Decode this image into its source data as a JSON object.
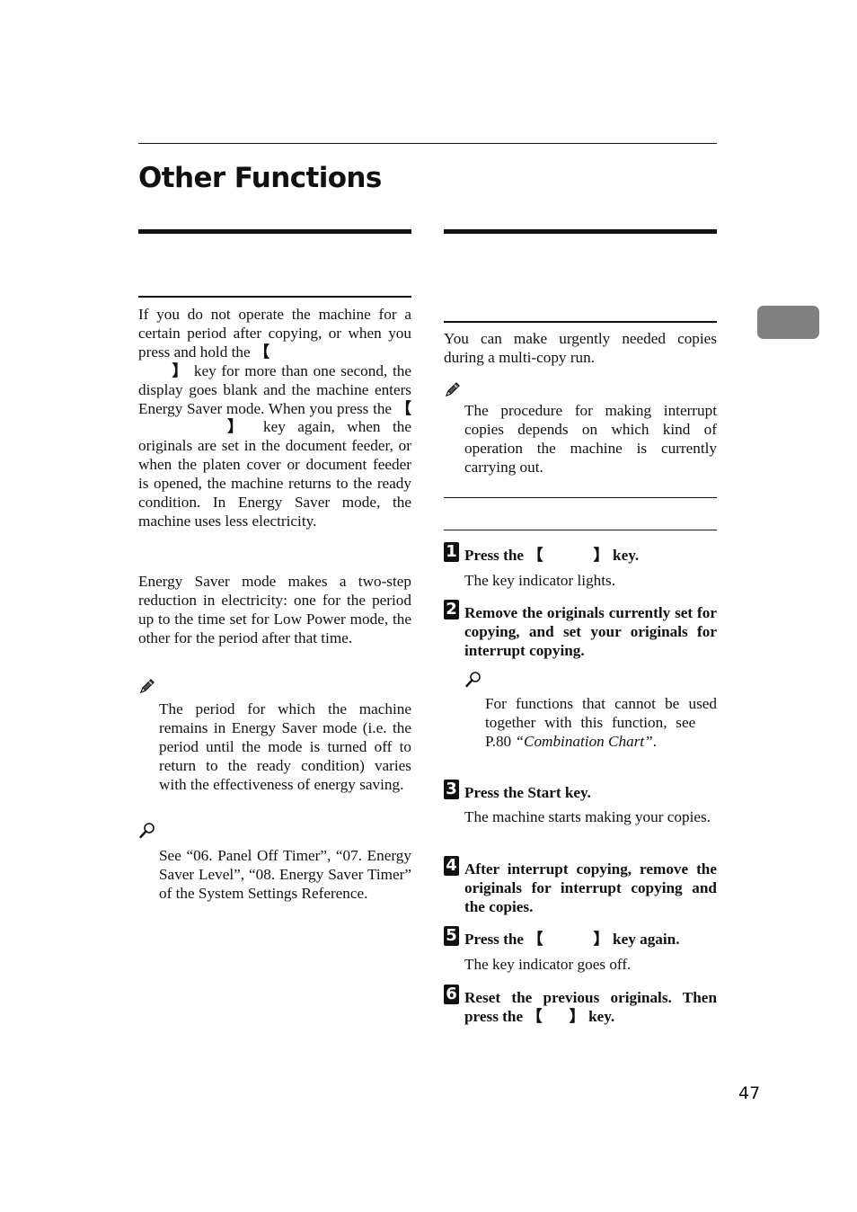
{
  "page": {
    "title": "Other Functions",
    "page_number": "47",
    "chapter_tab_label": ""
  },
  "left_column": {
    "section_heading": "",
    "subsection_heading": "",
    "para1_a": "If you do not operate the machine for a certain period after copying, or when you press and hold the ",
    "para1_b": " key for more than one second, the display goes blank and the machine enters Energy Saver mode. When you press the ",
    "para1_c": " key again, when the originals are set in the document feeder, or when the platen cover or document feeder is opened, the machine returns to the ready condition. In Energy Saver mode, the machine uses less electricity.",
    "para2": "Energy Saver mode makes a two-step reduction in electricity: one for the period up to the time set for Low Power mode, the other for the period after that time.",
    "note_icon": "pencil-icon",
    "note_text": "The period for which the machine remains in Energy Saver mode (i.e. the period until the mode is turned off to return to the ready condition) varies with the effectiveness of energy saving.",
    "reference_icon": "magnifier-icon",
    "reference_text": "See “06. Panel Off Timer”, “07. Energy Saver Level”, “08. Energy Saver Timer” of the System Settings Reference."
  },
  "right_column": {
    "section_heading": "",
    "subsection_heading": "",
    "intro": "You can make urgently needed copies during a multi-copy run.",
    "note_icon": "pencil-icon",
    "note_text": "The procedure for making interrupt copies depends on which kind of operation the machine is currently carrying out.",
    "procedure_heading": "",
    "steps": [
      {
        "num": "1",
        "title_a": "Press the ",
        "title_b": " key.",
        "body": "The key indicator lights."
      },
      {
        "num": "2",
        "title": "Remove the originals currently set for copying, and set your originals for interrupt copying.",
        "reference_icon": "magnifier-icon",
        "ref_a": "For functions that cannot be used together with this function, see ",
        "ref_page": "P.80",
        "ref_link": "“Combination Chart”",
        "ref_end": "."
      },
      {
        "num": "3",
        "title": "Press the Start key.",
        "body": "The machine starts making your copies."
      },
      {
        "num": "4",
        "title": "After interrupt copying, remove the originals for interrupt copying and the copies."
      },
      {
        "num": "5",
        "title_a": "Press the ",
        "title_b": " key again.",
        "body": "The key indicator goes off."
      },
      {
        "num": "6",
        "title_a": "Reset the previous originals. Then press the ",
        "title_b": " key."
      }
    ]
  },
  "symbols": {
    "open_bracket": "【",
    "close_bracket": "】"
  }
}
